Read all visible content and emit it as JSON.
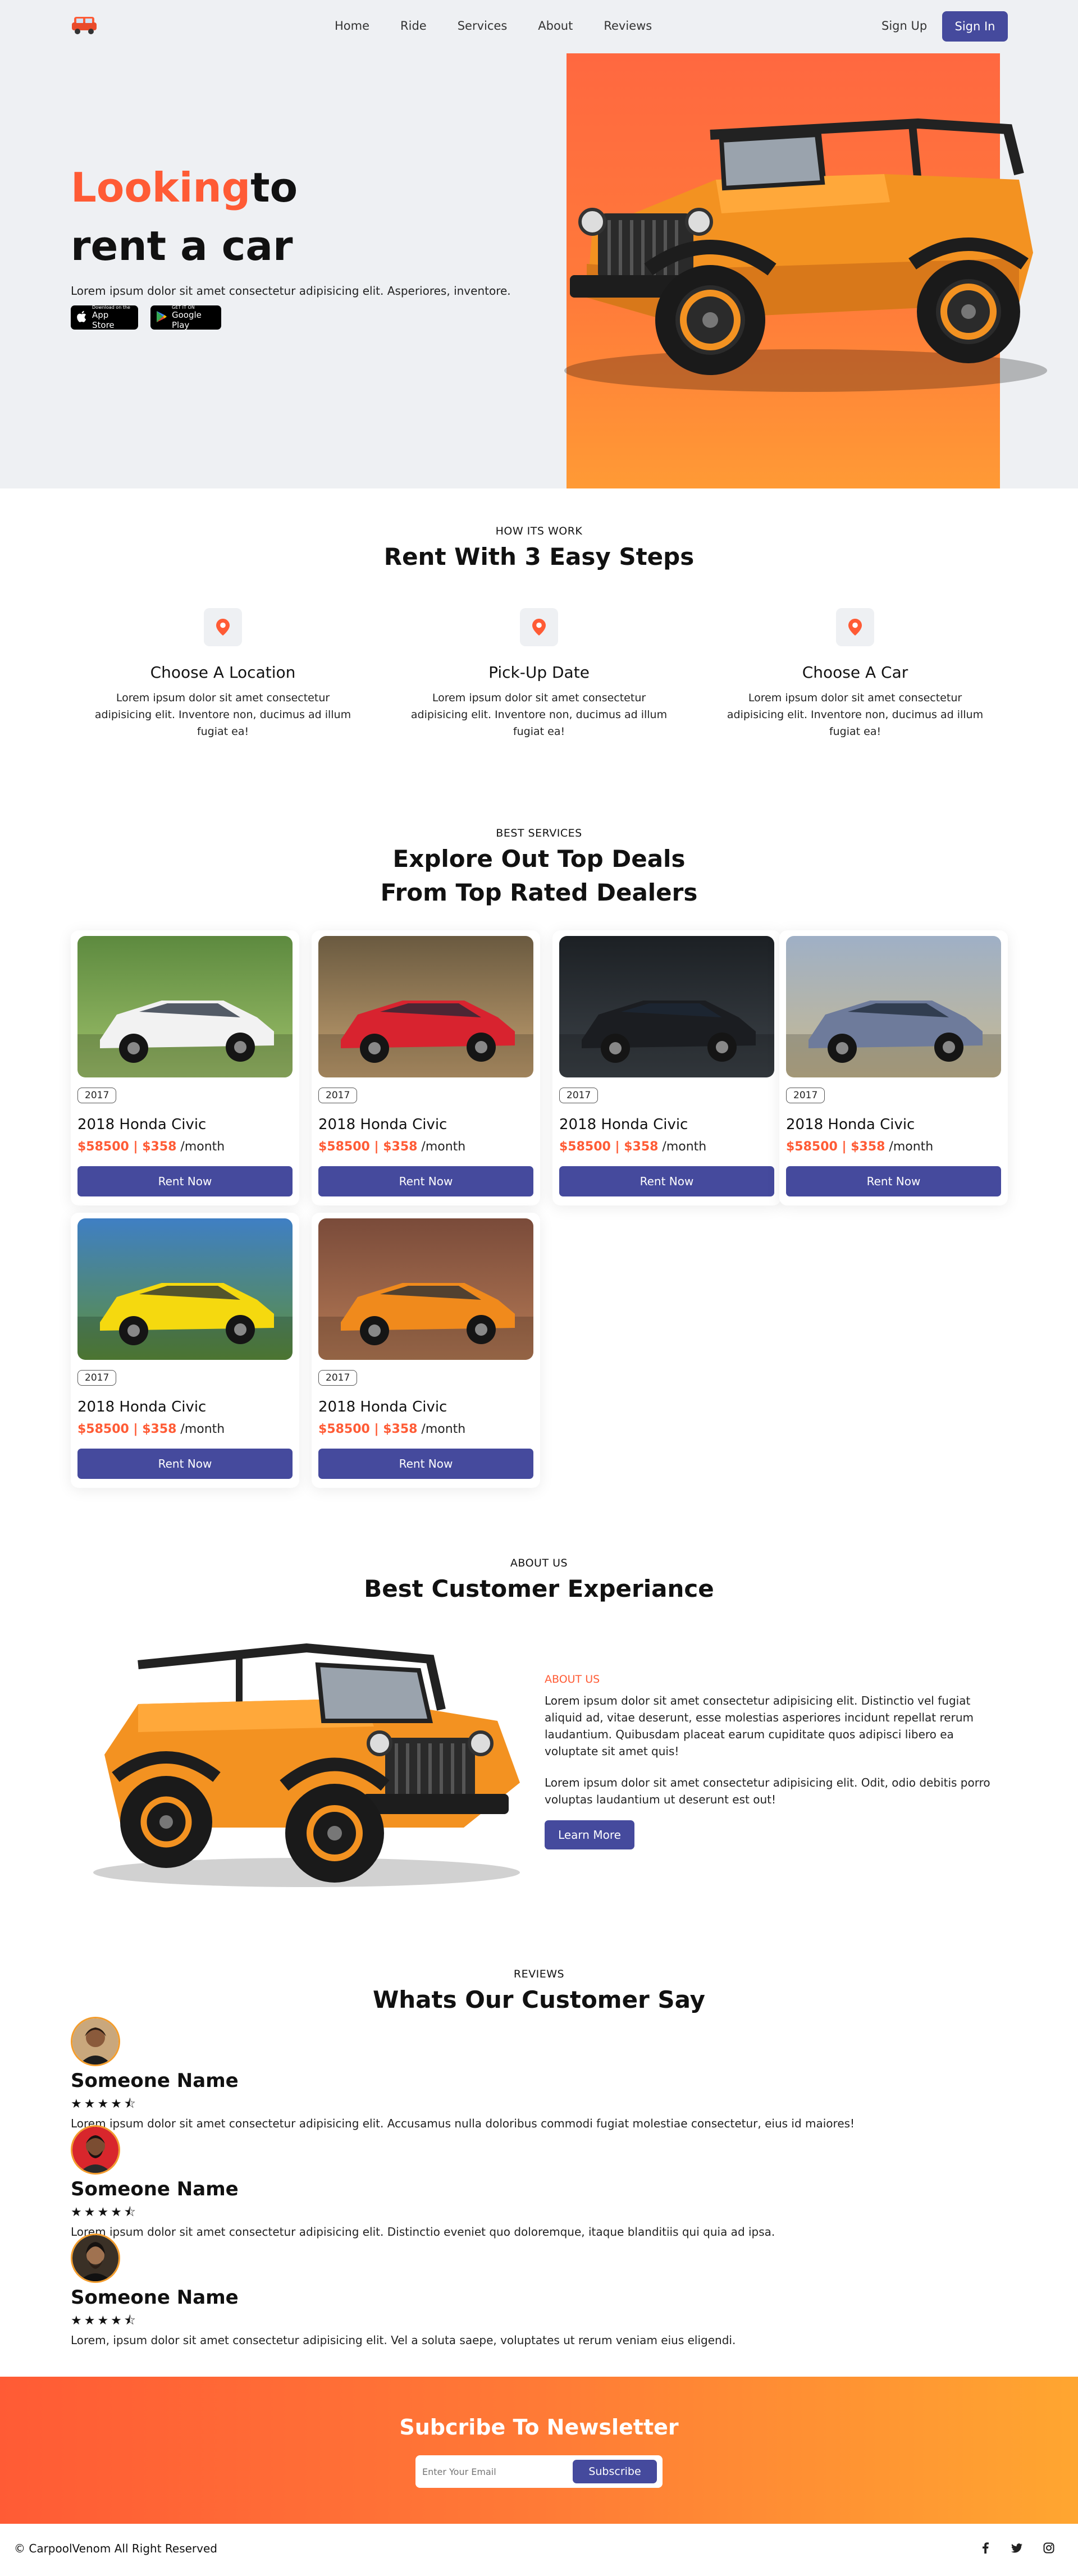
{
  "nav": {
    "logo_icon": "car-logo-icon",
    "links": [
      "Home",
      "Ride",
      "Services",
      "About",
      "Reviews"
    ],
    "signup": "Sign Up",
    "signin": "Sign In"
  },
  "hero": {
    "title_accent": "Looking",
    "title_rest": "to",
    "title_line2": "rent a car",
    "subtitle": "Lorem ipsum dolor sit amet consectetur adipisicing elit. Asperiores, inventore.",
    "app_store_small": "Download on the",
    "app_store_big": "App Store",
    "google_play_small": "GET IT ON",
    "google_play_big": "Google Play",
    "accent_color": "#ff5b35"
  },
  "steps": {
    "eyebrow": "HOW ITS WORK",
    "title": "Rent With 3 Easy Steps",
    "items": [
      {
        "icon": "location-pin-icon",
        "title": "Choose A Location",
        "text": "Lorem ipsum dolor sit amet consectetur adipisicing elit. Inventore non, ducimus ad illum fugiat ea!"
      },
      {
        "icon": "location-pin-icon",
        "title": "Pick-Up Date",
        "text": "Lorem ipsum dolor sit amet consectetur adipisicing elit. Inventore non, ducimus ad illum fugiat ea!"
      },
      {
        "icon": "location-pin-icon",
        "title": "Choose A Car",
        "text": "Lorem ipsum dolor sit amet consectetur adipisicing elit. Inventore non, ducimus ad illum fugiat ea!"
      }
    ]
  },
  "deals": {
    "eyebrow": "BEST SERVICES",
    "title_line1": "Explore Out Top Deals",
    "title_line2": "From Top Rated Dealers",
    "cards": [
      {
        "year": "2017",
        "name": "2018 Honda Civic",
        "price": "$58500 | $358",
        "period": " /month",
        "button": "Rent Now",
        "car_color": "#f2f2f2"
      },
      {
        "year": "2017",
        "name": "2018 Honda Civic",
        "price": "$58500 | $358",
        "period": " /month",
        "button": "Rent Now",
        "car_color": "#d8232f"
      },
      {
        "year": "2017",
        "name": "2018 Honda Civic",
        "price": "$58500 | $358",
        "period": " /month",
        "button": "Rent Now",
        "car_color": "#1b1d21"
      },
      {
        "year": "2017",
        "name": "2018 Honda Civic",
        "price": "$58500 | $358",
        "period": " /month",
        "button": "Rent Now",
        "car_color": "#6e7b9b"
      },
      {
        "year": "2017",
        "name": "2018 Honda Civic",
        "price": "$58500 | $358",
        "period": " /month",
        "button": "Rent Now",
        "car_color": "#f5d90f"
      },
      {
        "year": "2017",
        "name": "2018 Honda Civic",
        "price": "$58500 | $358",
        "period": " /month",
        "button": "Rent Now",
        "car_color": "#f08a1c"
      }
    ]
  },
  "about": {
    "eyebrow": "ABOUT US",
    "title": "Best Customer Experiance",
    "label": "ABOUT US",
    "para1": "Lorem ipsum dolor sit amet consectetur adipisicing elit. Distinctio vel fugiat aliquid ad, vitae deserunt, esse molestias asperiores incidunt repellat rerum laudantium. Quibusdam placeat earum cupiditate quos adipisci libero ea voluptate sit amet quis!",
    "para2": "Lorem ipsum dolor sit amet consectetur adipisicing elit. Odit, odio debitis porro voluptas laudantium ut deserunt est out!",
    "button": "Learn More"
  },
  "reviews": {
    "eyebrow": "REVIEWS",
    "title": "Whats Our Customer Say",
    "items": [
      {
        "name": "Someone Name",
        "stars": "★★★★⯪",
        "text": "Lorem ipsum dolor sit amet consectetur adipisicing elit. Accusamus nulla doloribus commodi fugiat molestiae consectetur, eius id maiores!"
      },
      {
        "name": "Someone Name",
        "stars": "★★★★⯪",
        "text": "Lorem ipsum dolor sit amet consectetur adipisicing elit. Distinctio eveniet quo doloremque, itaque blanditiis qui quia ad ipsa."
      },
      {
        "name": "Someone Name",
        "stars": "★★★★⯪",
        "text": "Lorem, ipsum dolor sit amet consectetur adipisicing elit. Vel a soluta saepe, voluptates ut rerum veniam eius eligendi."
      }
    ]
  },
  "newsletter": {
    "title": "Subcribe To Newsletter",
    "placeholder": "Enter Your Email",
    "button": "Subscribe"
  },
  "footer": {
    "copyright": "© CarpoolVenom All Right Reserved",
    "social_icons": [
      "facebook-icon",
      "twitter-icon",
      "instagram-icon"
    ]
  }
}
